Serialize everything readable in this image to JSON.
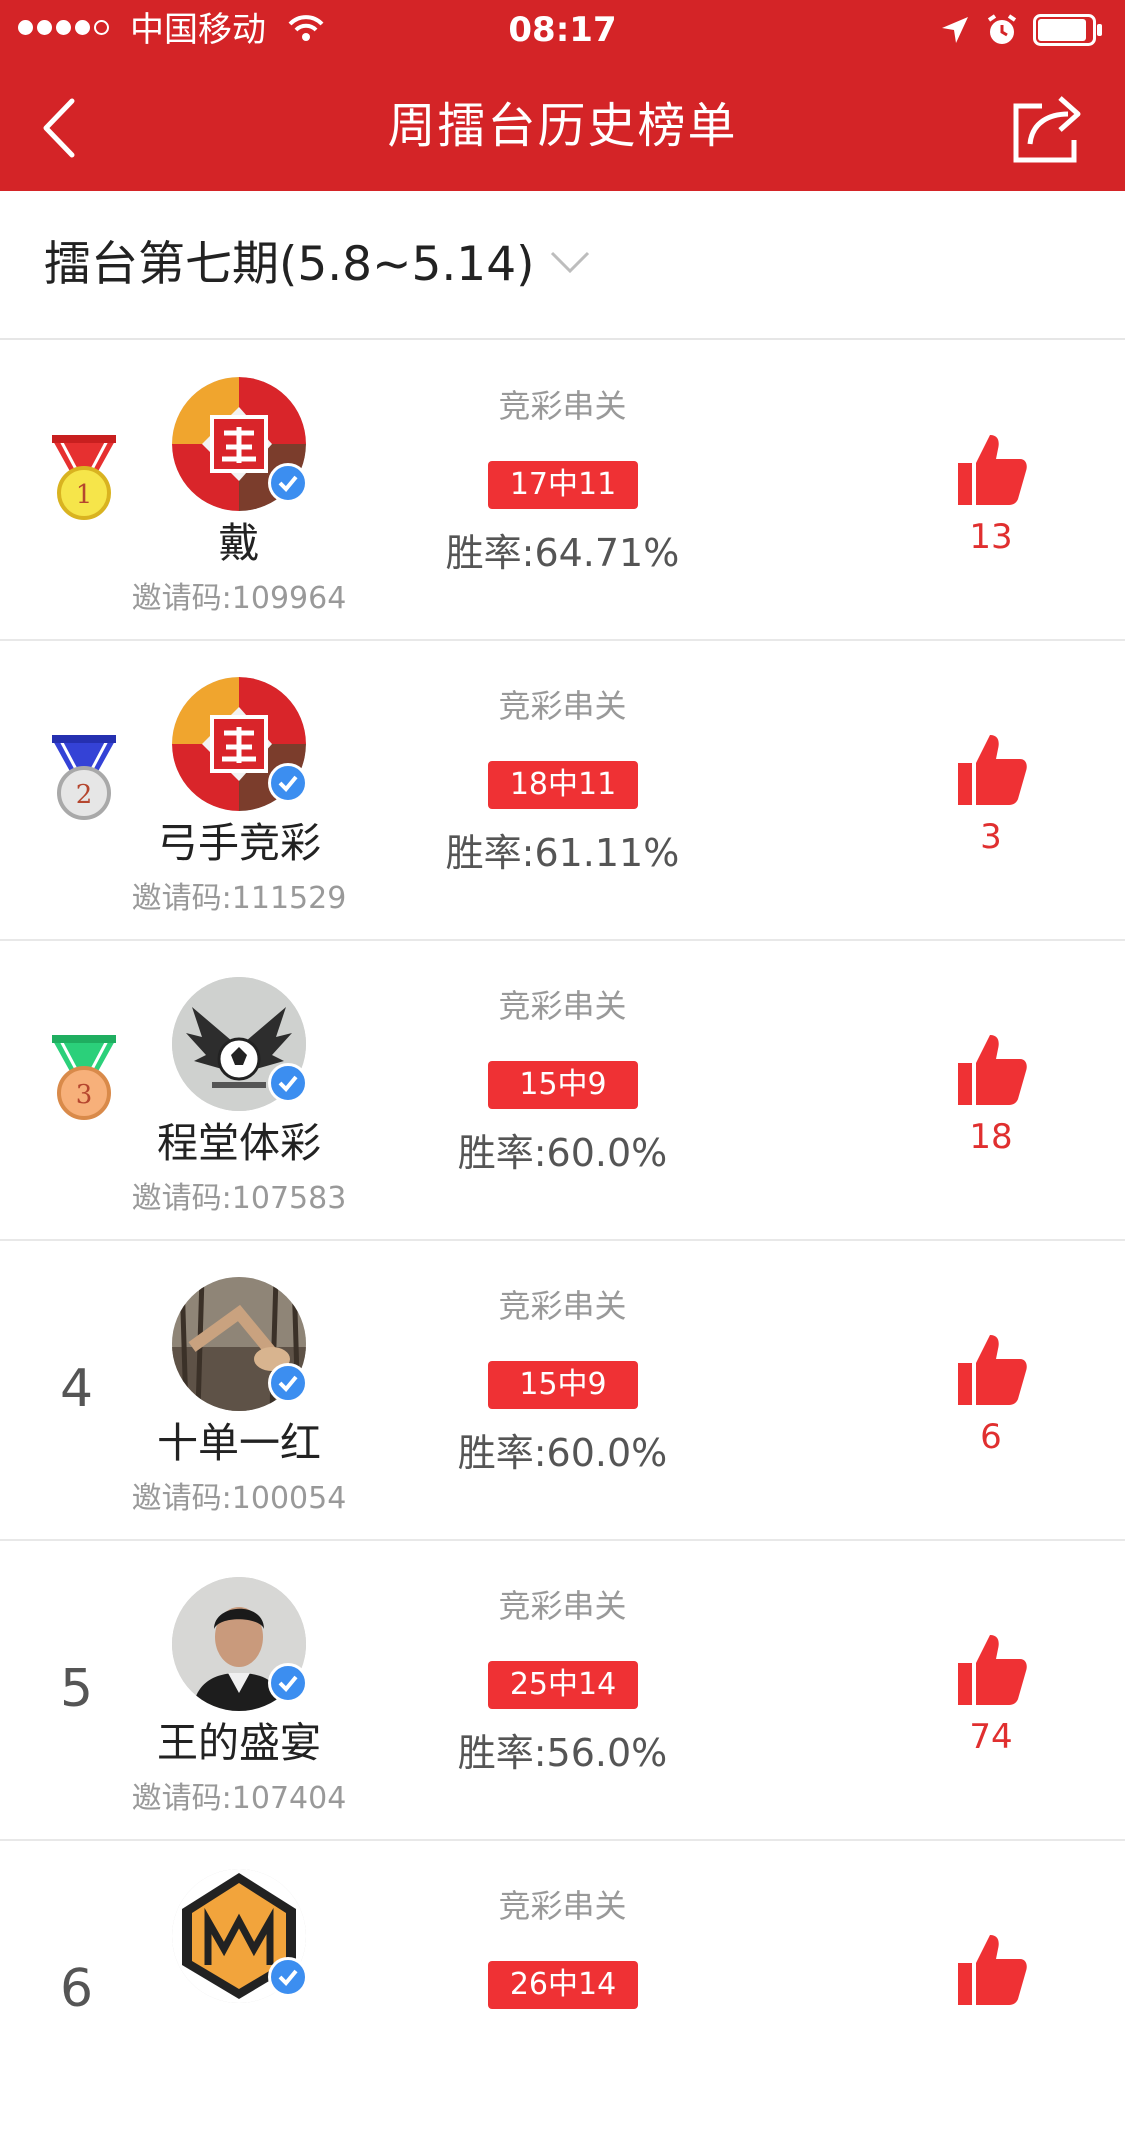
{
  "status_bar": {
    "carrier": "中国移动",
    "time": "08:17"
  },
  "nav": {
    "title": "周擂台历史榜单",
    "back_icon": "chevron-left-icon",
    "share_icon": "share-icon"
  },
  "period": {
    "label": "擂台第七期(5.8~5.14)",
    "icon": "chevron-down-icon"
  },
  "colors": {
    "header_red": "#d42427",
    "badge_red": "#ef3134",
    "like_red": "#e02f2f",
    "verified_blue": "#3c8ef0"
  },
  "rankings": [
    {
      "rank_medal": "1",
      "name": "戴",
      "invite": "邀请码:109964",
      "game": "竞彩串关",
      "record": "17中11",
      "winrate": "胜率:64.71%",
      "likes": "13"
    },
    {
      "rank_medal": "2",
      "name": "弓手竞彩",
      "invite": "邀请码:111529",
      "game": "竞彩串关",
      "record": "18中11",
      "winrate": "胜率:61.11%",
      "likes": "3"
    },
    {
      "rank_medal": "3",
      "name": "程堂体彩",
      "invite": "邀请码:107583",
      "game": "竞彩串关",
      "record": "15中9",
      "winrate": "胜率:60.0%",
      "likes": "18"
    },
    {
      "rank_num": "4",
      "name": "十单一红",
      "invite": "邀请码:100054",
      "game": "竞彩串关",
      "record": "15中9",
      "winrate": "胜率:60.0%",
      "likes": "6"
    },
    {
      "rank_num": "5",
      "name": "王的盛宴",
      "invite": "邀请码:107404",
      "game": "竞彩串关",
      "record": "25中14",
      "winrate": "胜率:56.0%",
      "likes": "74"
    },
    {
      "rank_num": "6",
      "game": "竞彩串关",
      "record": "26中14"
    }
  ]
}
